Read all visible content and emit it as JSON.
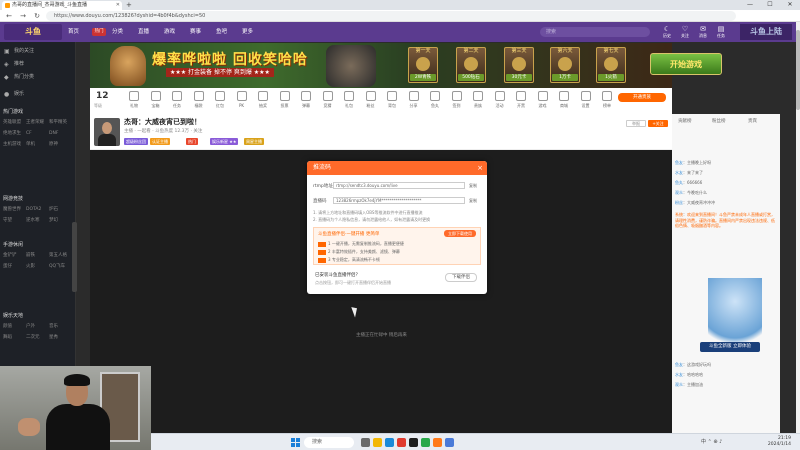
{
  "browser": {
    "tab_title": "杰哥的直播间_杰哥游戏_斗鱼直播",
    "new_tab": "+",
    "url": "https://www.douyu.com/123826?dyshid=4b0f4b&dyshci=50",
    "minimize": "—",
    "maximize": "☐",
    "close": "✕",
    "back": "←",
    "forward": "→",
    "reload": "↻"
  },
  "site": {
    "logo": "斗鱼",
    "nav": [
      "首页",
      "分类",
      "直播",
      "游戏",
      "赛事",
      "鱼吧",
      "更多"
    ],
    "hot_badge": "热门",
    "search_placeholder": "搜索",
    "header_icons": [
      {
        "glyph": "☾",
        "label": "历史"
      },
      {
        "glyph": "♡",
        "label": "关注"
      },
      {
        "glyph": "✉",
        "label": "消息"
      },
      {
        "glyph": "▤",
        "label": "任务"
      }
    ],
    "right_logo": "斗鱼上陆"
  },
  "sidebar": {
    "items": [
      {
        "icon": "▣",
        "label": "我的关注"
      },
      {
        "icon": "◈",
        "label": "推荐"
      },
      {
        "icon": "◆",
        "label": "热门分类"
      },
      {
        "icon": "●",
        "label": "娱乐"
      }
    ],
    "sections": [
      {
        "title": "热门游戏",
        "items": [
          "英雄联盟",
          "王者荣耀",
          "和平精英",
          "绝地求生",
          "CF",
          "DNF",
          "主机游戏",
          "单机",
          "原神"
        ]
      },
      {
        "title": "网游竞技",
        "items": [
          "魔兽世界",
          "DOTA2",
          "炉石",
          "守望",
          "逆水寒",
          "梦幻"
        ]
      },
      {
        "title": "手游休闲",
        "items": [
          "金铲铲",
          "崩铁",
          "第五人格",
          "蛋仔",
          "火影",
          "QQ飞车"
        ]
      },
      {
        "title": "娱乐天地",
        "items": [
          "颜值",
          "户外",
          "音乐",
          "舞蹈",
          "二次元",
          "星秀"
        ]
      }
    ]
  },
  "banner": {
    "title": "爆率哗啦啦 回收笑哈哈",
    "subtitle": "★★★ 打金装备 掉不停 爽到爆 ★★★",
    "days": [
      {
        "day": "第一天",
        "reward": "2W青铁"
      },
      {
        "day": "第二天",
        "reward": "500钻石"
      },
      {
        "day": "第三天",
        "reward": "30元卡"
      },
      {
        "day": "第六天",
        "reward": "1万卡"
      },
      {
        "day": "第七天",
        "reward": "1火箭"
      }
    ],
    "start_button": "开始游戏"
  },
  "toolbar": {
    "level": "12",
    "level_sub": "等级",
    "tools": [
      "礼物",
      "宝箱",
      "任务",
      "福袋",
      "红包",
      "PK",
      "抽奖",
      "投票",
      "弹幕",
      "竞猜",
      "礼包",
      "粉丝",
      "背包",
      "分享",
      "鱼丸",
      "签到",
      "贵族",
      "活动",
      "开黑",
      "游戏",
      "商城",
      "设置",
      "榜单"
    ],
    "red_button": "开通贵族"
  },
  "streamer": {
    "name": "杰哥：大威夜宵已到啦！",
    "meta": "主播 · 一起看 · 斗鱼热度 12.3万 · 关注",
    "tags": [
      {
        "text": "超级粉丝团",
        "color": "#7a5bd8"
      },
      {
        "text": "认证主播",
        "color": "#f29a1a"
      },
      {
        "text": "热门",
        "color": "#e8462b"
      },
      {
        "text": "娱乐新星 ★★",
        "color": "#8a5bd8"
      },
      {
        "text": "周星主播",
        "color": "#d9a21a"
      }
    ],
    "report": "举报",
    "follow": "+关注"
  },
  "video": {
    "hint": "主播正在忙碌中 稍后再来"
  },
  "modal": {
    "title": "推流码",
    "close": "×",
    "server_label": "rtmp地址",
    "server_value": "rtmp://sendtc3.douyu.com/live",
    "server_copy": "复制",
    "key_label": "直播码",
    "key_value": "123826rmpzOk7e4jYM********************",
    "key_copy": "复制",
    "notes": [
      "1. 请将上方地址和直播码填入OBS等推流软件中进行直播推流",
      "2. 直播码为个人隐私信息，请勿泄露给他人，如有泄露请及时更换"
    ],
    "promo": {
      "title": "斗鱼直播伴侣·一键开播 更简单",
      "button": "立即下载使用",
      "lines": [
        "1 一键开播，无需复制推流码，直播更便捷",
        "2 丰富特效插件，支持美颜、滤镜、弹幕",
        "3 专业稳定，高清流畅不卡顿"
      ]
    },
    "download_title": "已安装斗鱼直播伴侣？",
    "download_sub": "点击按钮，即可一键打开直播伴侣开始直播",
    "download_button": "下载伴侣"
  },
  "right_panel": {
    "tabs": [
      "贡献榜",
      "粉丝榜",
      "贵宾"
    ],
    "chats": [
      {
        "user": "鱼友",
        "text": "主播晚上好呀"
      },
      {
        "user": "水友",
        "text": "来了来了"
      },
      {
        "user": "鱼丸",
        "text": "666666"
      },
      {
        "user": "观众",
        "text": "今晚吃什么"
      },
      {
        "user": "粉丝",
        "text": "大威夜宵冲冲冲"
      },
      {
        "user": "系统",
        "text": "欢迎来到直播间！斗鱼严禁未成年人直播或打赏，请理性消费，谨防诈骗。直播间内严禁出现违法违规、低俗色情、吸烟酗酒等内容。"
      },
      {
        "user": "鱼友",
        "text": "这游戏好玩吗"
      },
      {
        "user": "水友",
        "text": "哈哈哈哈"
      },
      {
        "user": "观众",
        "text": "主播加油"
      }
    ],
    "anime_button": "斗鱼全新版 立即体验"
  },
  "taskbar": {
    "search": "搜索",
    "time": "21:19",
    "date": "2024/1/14",
    "tray": "中  ⌃  ⊕  ♪"
  }
}
